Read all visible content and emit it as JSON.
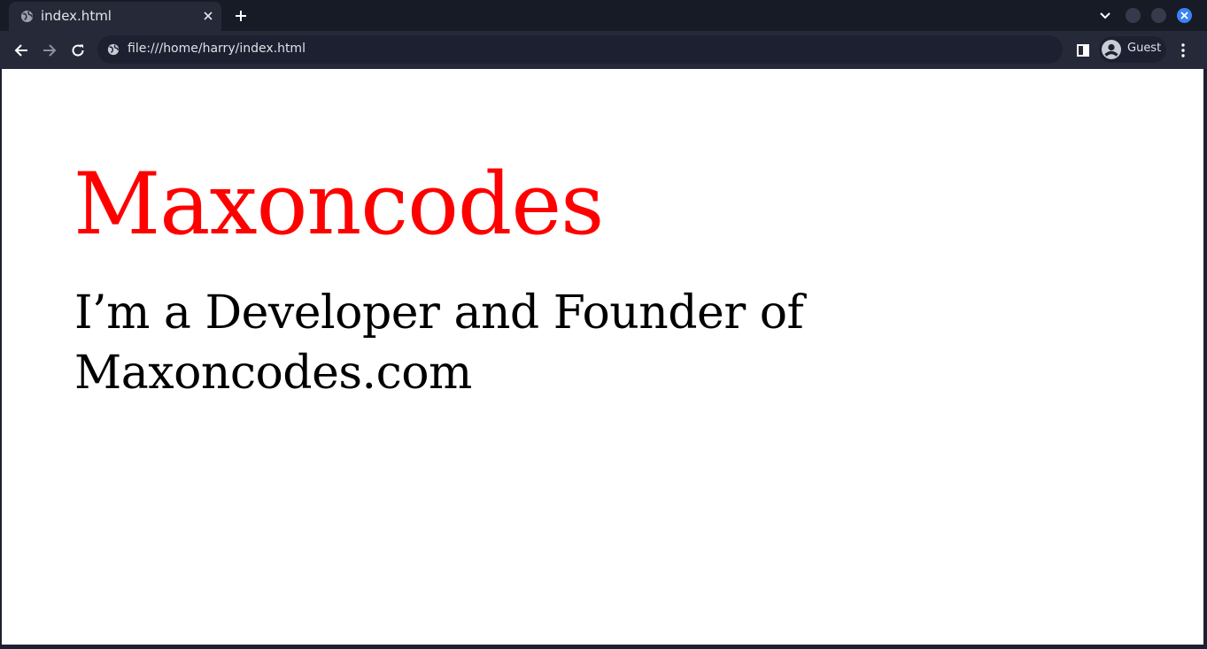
{
  "browser": {
    "tab": {
      "title": "index.html",
      "icon": "globe-icon"
    },
    "toolbar": {
      "url": "file:///home/harry/index.html",
      "profile_label": "Guest"
    },
    "colors": {
      "tabstrip_bg": "#171b26",
      "toolbar_bg": "#262a38",
      "close_accent": "#3b82f6"
    }
  },
  "page": {
    "heading": "Maxoncodes",
    "subtitle": "I’m a Developer and Founder of Maxoncodes.com",
    "heading_color": "#ff0000"
  }
}
